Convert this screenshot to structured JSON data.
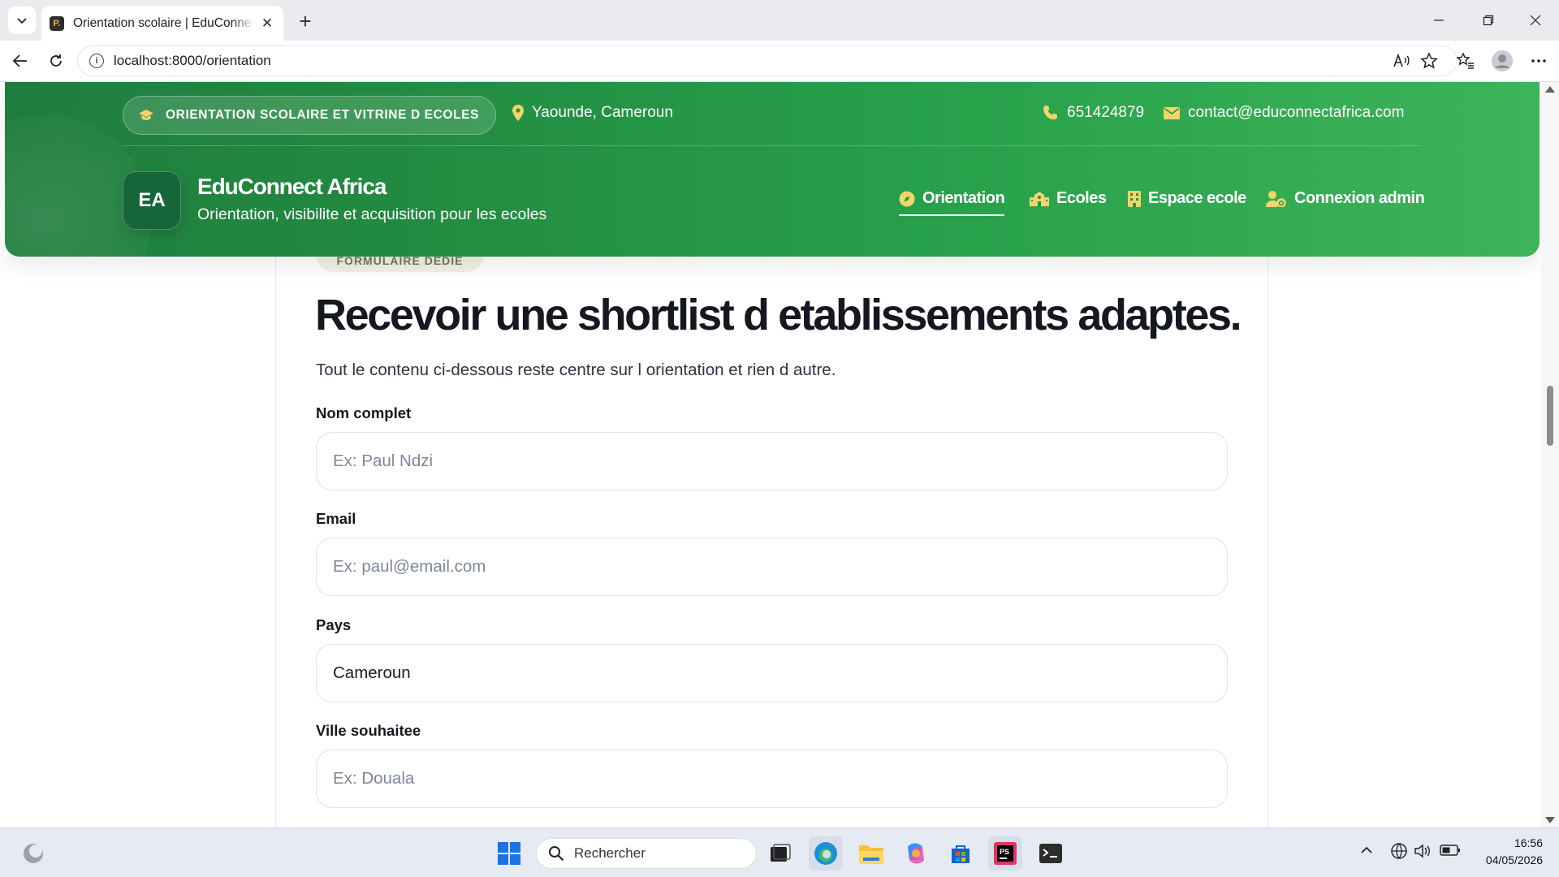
{
  "browser": {
    "tab_title": "Orientation scolaire | EduConnect Africa",
    "favicon_label": "P.",
    "url": "localhost:8000/orientation"
  },
  "header": {
    "pill_label": "ORIENTATION SCOLAIRE ET VITRINE D ECOLES",
    "location": "Yaounde, Cameroun",
    "phone": "651424879",
    "email": "contact@educonnectafrica.com",
    "logo_initials": "EA",
    "brand_name": "EduConnect Africa",
    "brand_tagline": "Orientation, visibilite et acquisition pour les ecoles",
    "nav": [
      {
        "label": "Orientation",
        "icon": "compass-icon",
        "active": true
      },
      {
        "label": "Ecoles",
        "icon": "school-icon",
        "active": false
      },
      {
        "label": "Espace ecole",
        "icon": "building-icon",
        "active": false
      },
      {
        "label": "Connexion admin",
        "icon": "user-gear-icon",
        "active": false
      }
    ]
  },
  "form": {
    "badge": "FORMULAIRE DEDIE",
    "title": "Recevoir une shortlist d etablissements adaptes.",
    "lead": "Tout le contenu ci-dessous reste centre sur l orientation et rien d autre.",
    "fields": [
      {
        "label": "Nom complet",
        "value": "",
        "placeholder": "Ex: Paul Ndzi"
      },
      {
        "label": "Email",
        "value": "",
        "placeholder": "Ex: paul@email.com"
      },
      {
        "label": "Pays",
        "value": "Cameroun",
        "placeholder": ""
      },
      {
        "label": "Ville souhaitee",
        "value": "",
        "placeholder": "Ex: Douala"
      }
    ]
  },
  "taskbar": {
    "search_placeholder": "Rechercher",
    "time": "16:56",
    "date": "04/05/2026"
  },
  "colors": {
    "header_green_start": "#1f7d3e",
    "header_green_end": "#3db45a",
    "accent_yellow": "#f5d56b"
  }
}
